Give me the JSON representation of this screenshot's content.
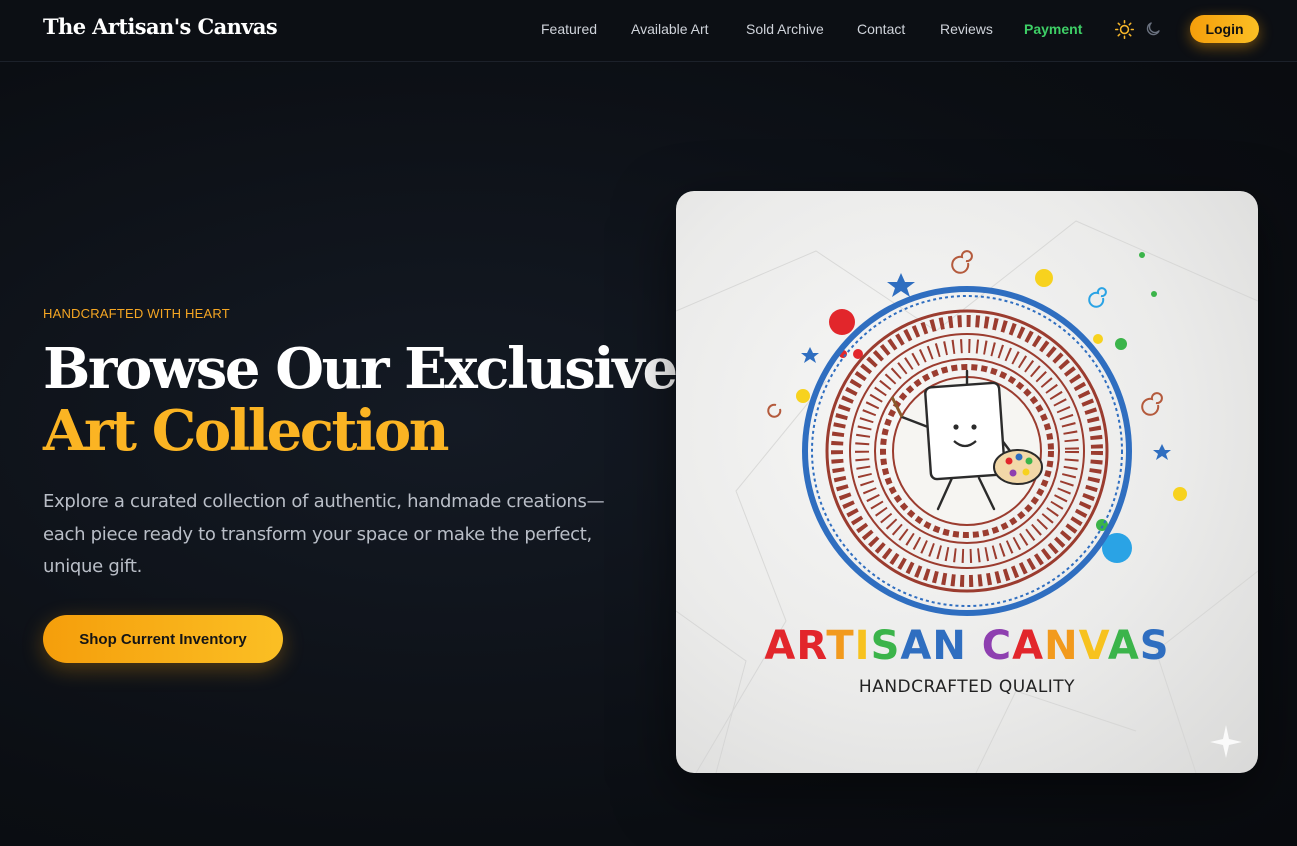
{
  "header": {
    "brand": "The Artisan's Canvas",
    "nav": [
      {
        "label": "Featured"
      },
      {
        "label": "Available Art"
      },
      {
        "label": "Sold Archive"
      },
      {
        "label": "Contact"
      },
      {
        "label": "Reviews"
      },
      {
        "label": "Payment"
      }
    ],
    "theme_icons": [
      "sun-icon",
      "moon-icon"
    ],
    "login_label": "Login"
  },
  "hero": {
    "eyebrow": "HANDCRAFTED WITH HEART",
    "headline_line1": "Browse Our Exclusive",
    "headline_line2": "Art Collection",
    "lead": "Explore a curated collection of authentic, handmade creations—each piece ready to transform your space or make the perfect, unique gift.",
    "cta_label": "Shop Current Inventory"
  },
  "artwork": {
    "logo_letters": [
      "A",
      "R",
      "T",
      "I",
      "S",
      "A",
      "N",
      " ",
      "C",
      "A",
      "N",
      "V",
      "A",
      "S"
    ],
    "tagline": "HANDCRAFTED QUALITY"
  },
  "colors": {
    "accent": "#fbbf24",
    "accent_dark": "#f59e0b",
    "payment": "#3ecf66",
    "background": "#0b0e13"
  }
}
